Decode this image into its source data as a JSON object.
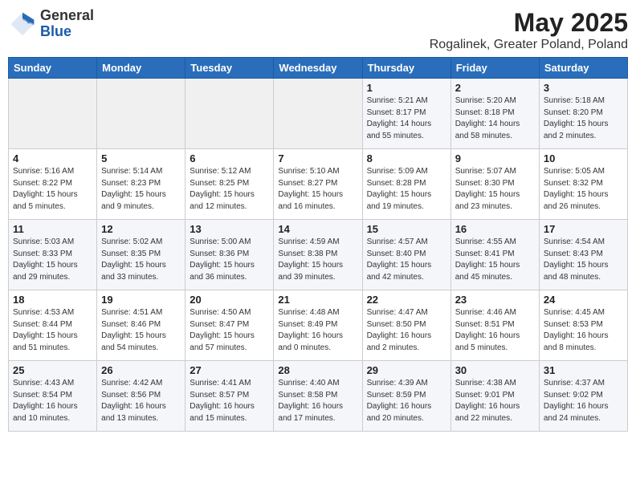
{
  "header": {
    "logo_general": "General",
    "logo_blue": "Blue",
    "month_year": "May 2025",
    "location": "Rogalinek, Greater Poland, Poland"
  },
  "weekdays": [
    "Sunday",
    "Monday",
    "Tuesday",
    "Wednesday",
    "Thursday",
    "Friday",
    "Saturday"
  ],
  "weeks": [
    [
      {
        "day": "",
        "info": ""
      },
      {
        "day": "",
        "info": ""
      },
      {
        "day": "",
        "info": ""
      },
      {
        "day": "",
        "info": ""
      },
      {
        "day": "1",
        "info": "Sunrise: 5:21 AM\nSunset: 8:17 PM\nDaylight: 14 hours\nand 55 minutes."
      },
      {
        "day": "2",
        "info": "Sunrise: 5:20 AM\nSunset: 8:18 PM\nDaylight: 14 hours\nand 58 minutes."
      },
      {
        "day": "3",
        "info": "Sunrise: 5:18 AM\nSunset: 8:20 PM\nDaylight: 15 hours\nand 2 minutes."
      }
    ],
    [
      {
        "day": "4",
        "info": "Sunrise: 5:16 AM\nSunset: 8:22 PM\nDaylight: 15 hours\nand 5 minutes."
      },
      {
        "day": "5",
        "info": "Sunrise: 5:14 AM\nSunset: 8:23 PM\nDaylight: 15 hours\nand 9 minutes."
      },
      {
        "day": "6",
        "info": "Sunrise: 5:12 AM\nSunset: 8:25 PM\nDaylight: 15 hours\nand 12 minutes."
      },
      {
        "day": "7",
        "info": "Sunrise: 5:10 AM\nSunset: 8:27 PM\nDaylight: 15 hours\nand 16 minutes."
      },
      {
        "day": "8",
        "info": "Sunrise: 5:09 AM\nSunset: 8:28 PM\nDaylight: 15 hours\nand 19 minutes."
      },
      {
        "day": "9",
        "info": "Sunrise: 5:07 AM\nSunset: 8:30 PM\nDaylight: 15 hours\nand 23 minutes."
      },
      {
        "day": "10",
        "info": "Sunrise: 5:05 AM\nSunset: 8:32 PM\nDaylight: 15 hours\nand 26 minutes."
      }
    ],
    [
      {
        "day": "11",
        "info": "Sunrise: 5:03 AM\nSunset: 8:33 PM\nDaylight: 15 hours\nand 29 minutes."
      },
      {
        "day": "12",
        "info": "Sunrise: 5:02 AM\nSunset: 8:35 PM\nDaylight: 15 hours\nand 33 minutes."
      },
      {
        "day": "13",
        "info": "Sunrise: 5:00 AM\nSunset: 8:36 PM\nDaylight: 15 hours\nand 36 minutes."
      },
      {
        "day": "14",
        "info": "Sunrise: 4:59 AM\nSunset: 8:38 PM\nDaylight: 15 hours\nand 39 minutes."
      },
      {
        "day": "15",
        "info": "Sunrise: 4:57 AM\nSunset: 8:40 PM\nDaylight: 15 hours\nand 42 minutes."
      },
      {
        "day": "16",
        "info": "Sunrise: 4:55 AM\nSunset: 8:41 PM\nDaylight: 15 hours\nand 45 minutes."
      },
      {
        "day": "17",
        "info": "Sunrise: 4:54 AM\nSunset: 8:43 PM\nDaylight: 15 hours\nand 48 minutes."
      }
    ],
    [
      {
        "day": "18",
        "info": "Sunrise: 4:53 AM\nSunset: 8:44 PM\nDaylight: 15 hours\nand 51 minutes."
      },
      {
        "day": "19",
        "info": "Sunrise: 4:51 AM\nSunset: 8:46 PM\nDaylight: 15 hours\nand 54 minutes."
      },
      {
        "day": "20",
        "info": "Sunrise: 4:50 AM\nSunset: 8:47 PM\nDaylight: 15 hours\nand 57 minutes."
      },
      {
        "day": "21",
        "info": "Sunrise: 4:48 AM\nSunset: 8:49 PM\nDaylight: 16 hours\nand 0 minutes."
      },
      {
        "day": "22",
        "info": "Sunrise: 4:47 AM\nSunset: 8:50 PM\nDaylight: 16 hours\nand 2 minutes."
      },
      {
        "day": "23",
        "info": "Sunrise: 4:46 AM\nSunset: 8:51 PM\nDaylight: 16 hours\nand 5 minutes."
      },
      {
        "day": "24",
        "info": "Sunrise: 4:45 AM\nSunset: 8:53 PM\nDaylight: 16 hours\nand 8 minutes."
      }
    ],
    [
      {
        "day": "25",
        "info": "Sunrise: 4:43 AM\nSunset: 8:54 PM\nDaylight: 16 hours\nand 10 minutes."
      },
      {
        "day": "26",
        "info": "Sunrise: 4:42 AM\nSunset: 8:56 PM\nDaylight: 16 hours\nand 13 minutes."
      },
      {
        "day": "27",
        "info": "Sunrise: 4:41 AM\nSunset: 8:57 PM\nDaylight: 16 hours\nand 15 minutes."
      },
      {
        "day": "28",
        "info": "Sunrise: 4:40 AM\nSunset: 8:58 PM\nDaylight: 16 hours\nand 17 minutes."
      },
      {
        "day": "29",
        "info": "Sunrise: 4:39 AM\nSunset: 8:59 PM\nDaylight: 16 hours\nand 20 minutes."
      },
      {
        "day": "30",
        "info": "Sunrise: 4:38 AM\nSunset: 9:01 PM\nDaylight: 16 hours\nand 22 minutes."
      },
      {
        "day": "31",
        "info": "Sunrise: 4:37 AM\nSunset: 9:02 PM\nDaylight: 16 hours\nand 24 minutes."
      }
    ]
  ]
}
